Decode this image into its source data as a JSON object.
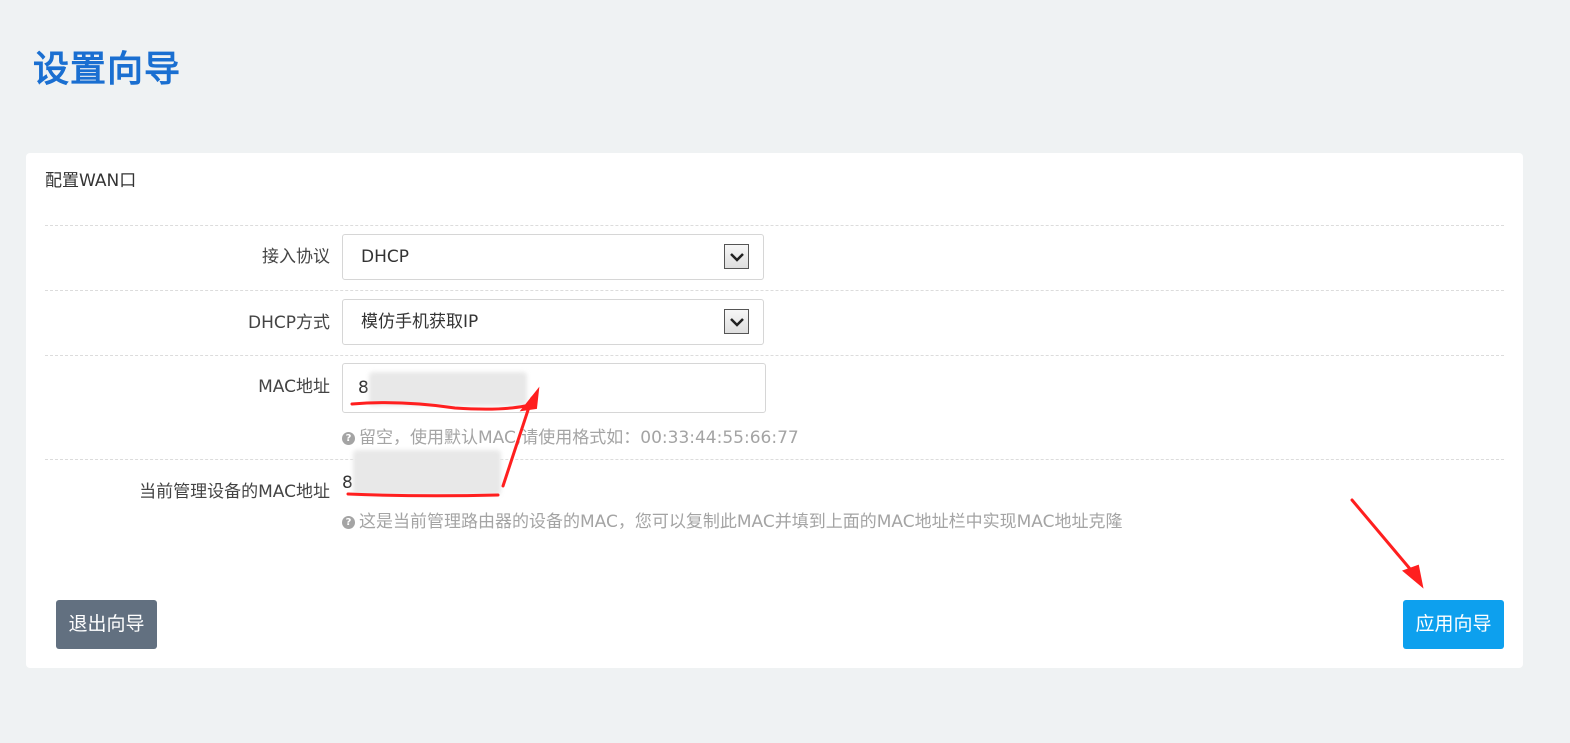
{
  "page": {
    "title": "设置向导"
  },
  "card": {
    "title": "配置WAN口",
    "rows": {
      "protocol": {
        "label": "接入协议",
        "value": "DHCP"
      },
      "dhcp_mode": {
        "label": "DHCP方式",
        "value": "模仿手机获取IP"
      },
      "mac": {
        "label": "MAC地址",
        "value": "8",
        "hint": "留空，使用默认MAC,请使用格式如：00:33:44:55:66:77"
      },
      "current_mac": {
        "label": "当前管理设备的MAC地址",
        "value": "8",
        "hint": "这是当前管理路由器的设备的MAC，您可以复制此MAC并填到上面的MAC地址栏中实现MAC地址克隆"
      }
    }
  },
  "buttons": {
    "exit_label": "退出向导",
    "apply_label": "应用向导"
  },
  "colors": {
    "title": "#1a6fd1",
    "exit_button": "#627080",
    "apply_button": "#0da0ee",
    "annotation": "#ff1f1f",
    "background": "#eff2f3"
  },
  "icons": {
    "select_arrow": "chevron-down-icon",
    "help": "question-circle-icon"
  }
}
